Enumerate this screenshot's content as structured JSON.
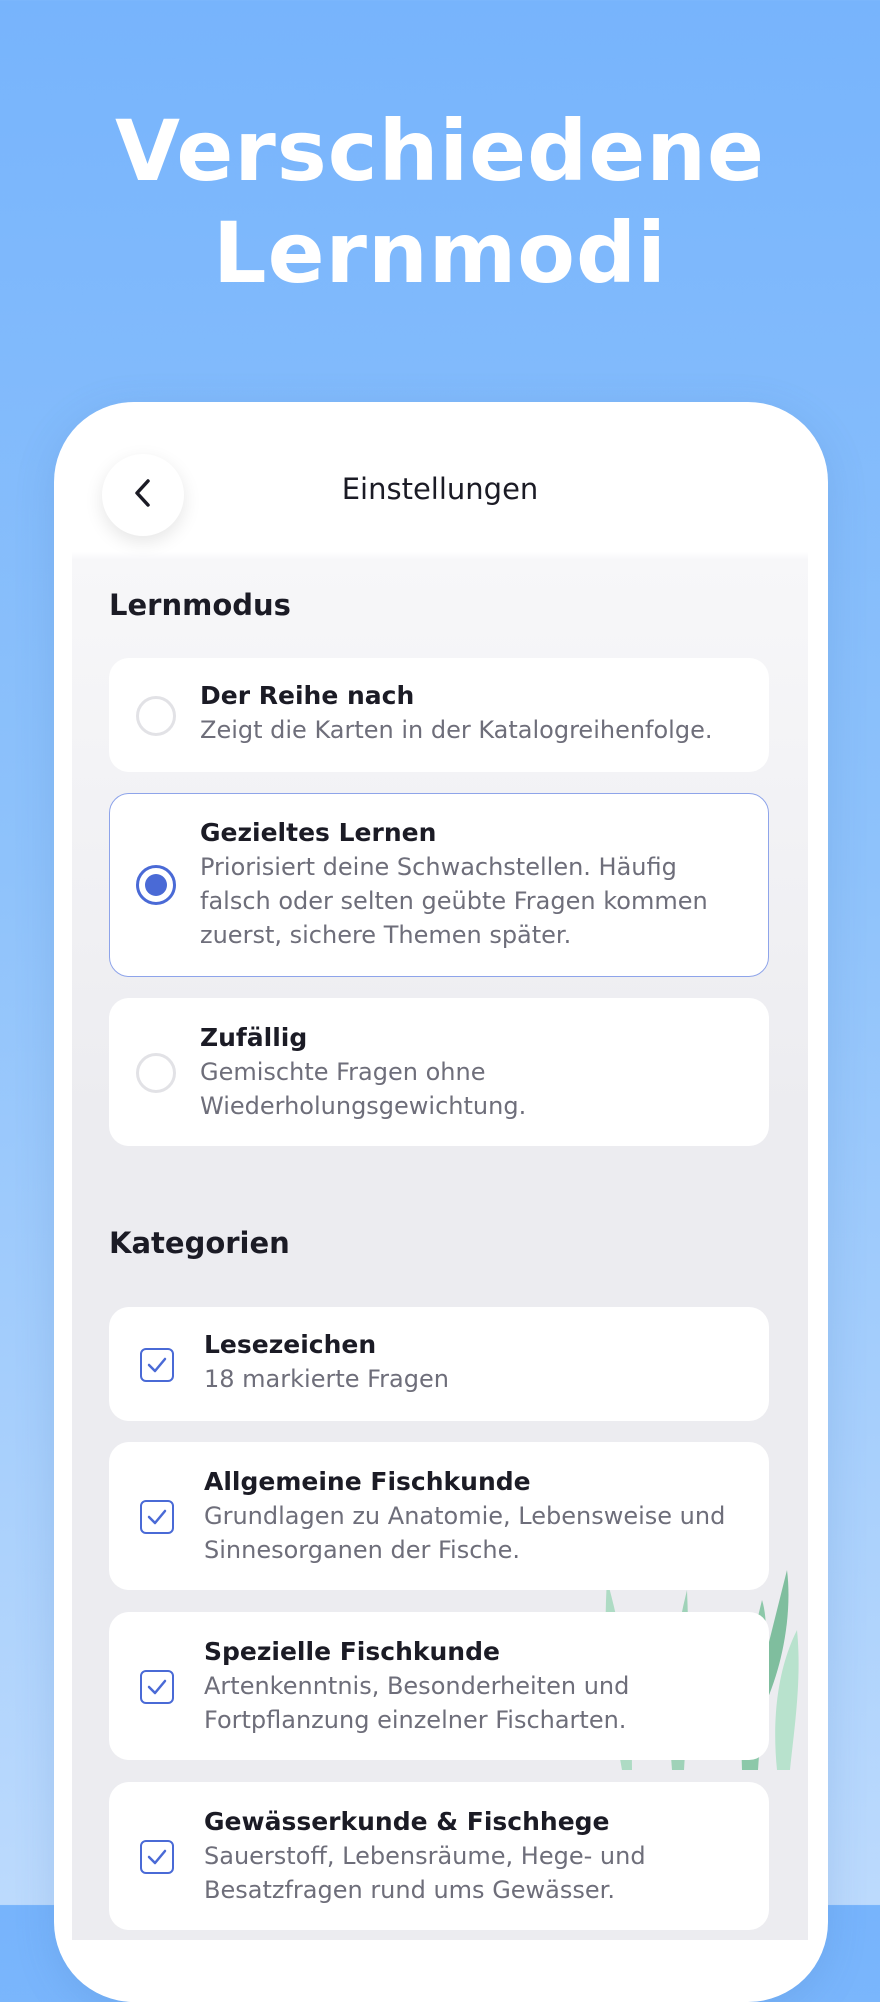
{
  "headline": {
    "line1": "Verschiedene",
    "line2": "Lernmodi"
  },
  "header": {
    "title": "Einstellungen",
    "back_icon": "chevron-left-icon"
  },
  "lernmodus": {
    "heading": "Lernmodus",
    "options": [
      {
        "title": "Der Reihe nach",
        "description": "Zeigt die Karten in der Katalogreihenfolge.",
        "selected": false
      },
      {
        "title": "Gezieltes Lernen",
        "description_lines": [
          "Priorisiert deine Schwachstellen. Häufig",
          "falsch oder selten geübte Fragen kommen",
          "zuerst, sichere Themen später."
        ],
        "selected": true
      },
      {
        "title": "Zufällig",
        "description_lines": [
          "Gemischte Fragen ohne",
          "Wiederholungsgewichtung."
        ],
        "selected": false
      }
    ]
  },
  "kategorien": {
    "heading": "Kategorien",
    "items": [
      {
        "title": "Lesezeichen",
        "description": "18 markierte Fragen",
        "checked": true
      },
      {
        "title": "Allgemeine Fischkunde",
        "description_lines": [
          "Grundlagen zu Anatomie, Lebensweise und",
          "Sinnesorganen der Fische."
        ],
        "checked": true
      },
      {
        "title": "Spezielle Fischkunde",
        "description_lines": [
          "Artenkenntnis, Besonderheiten und",
          "Fortpflanzung einzelner Fischarten."
        ],
        "checked": true
      },
      {
        "title": "Gewässerkunde & Fischhege",
        "description_lines": [
          "Sauerstoff, Lebensräume, Hege- und",
          "Besatzfragen rund ums Gewässer."
        ],
        "checked": true
      }
    ]
  },
  "colors": {
    "accent": "#4a6ad6",
    "background_top": "#77b4fc",
    "selected_border": "#8ea4ea"
  }
}
